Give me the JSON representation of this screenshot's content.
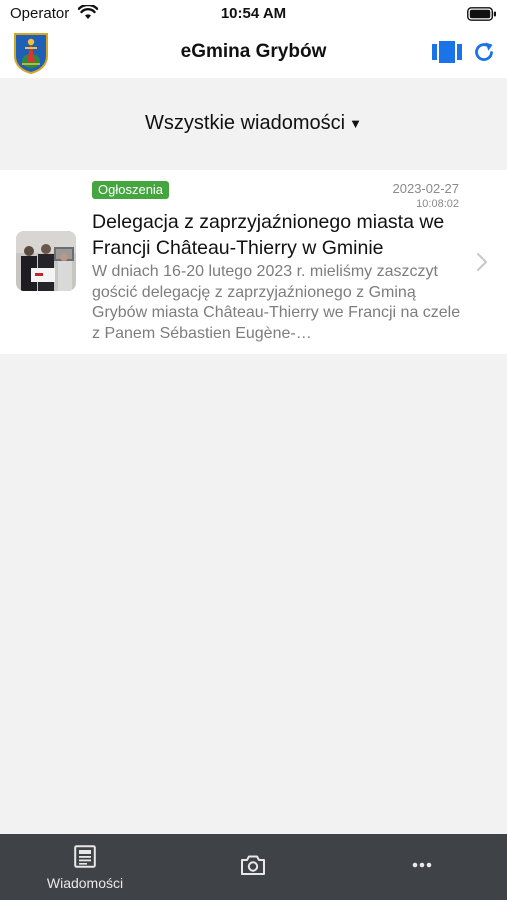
{
  "status_bar": {
    "carrier": "Operator",
    "time": "10:54 AM"
  },
  "nav_bar": {
    "title": "eGmina Grybów",
    "crest_icon": "municipal-crest-icon",
    "carousel_icon": "carousel-icon",
    "refresh_icon": "refresh-icon",
    "accent_color": "#1a73e8"
  },
  "filter": {
    "label": "Wszystkie wiadomości",
    "dropdown_glyph": "▼"
  },
  "messages": [
    {
      "category": "Ogłoszenia",
      "category_color": "#45a640",
      "date": "2023-02-27",
      "time": "10:08:02",
      "title": "Delegacja z zaprzyjaźnionego miasta we Francji Château-Thierry w Gminie",
      "excerpt": "W dniach 16-20 lutego 2023 r. mieliśmy zaszczyt gościć delegację z zaprzyjaźnionego z Gminą Grybów miasta Château-Thierry we Francji na czele z Panem Sébastien Eugène-…"
    }
  ],
  "tab_bar": {
    "tabs": [
      {
        "label": "Wiadomości",
        "icon": "newspaper-icon"
      },
      {
        "label": "",
        "icon": "camera-icon"
      },
      {
        "label": "",
        "icon": "more-icon"
      }
    ],
    "background": "#3f4246"
  }
}
